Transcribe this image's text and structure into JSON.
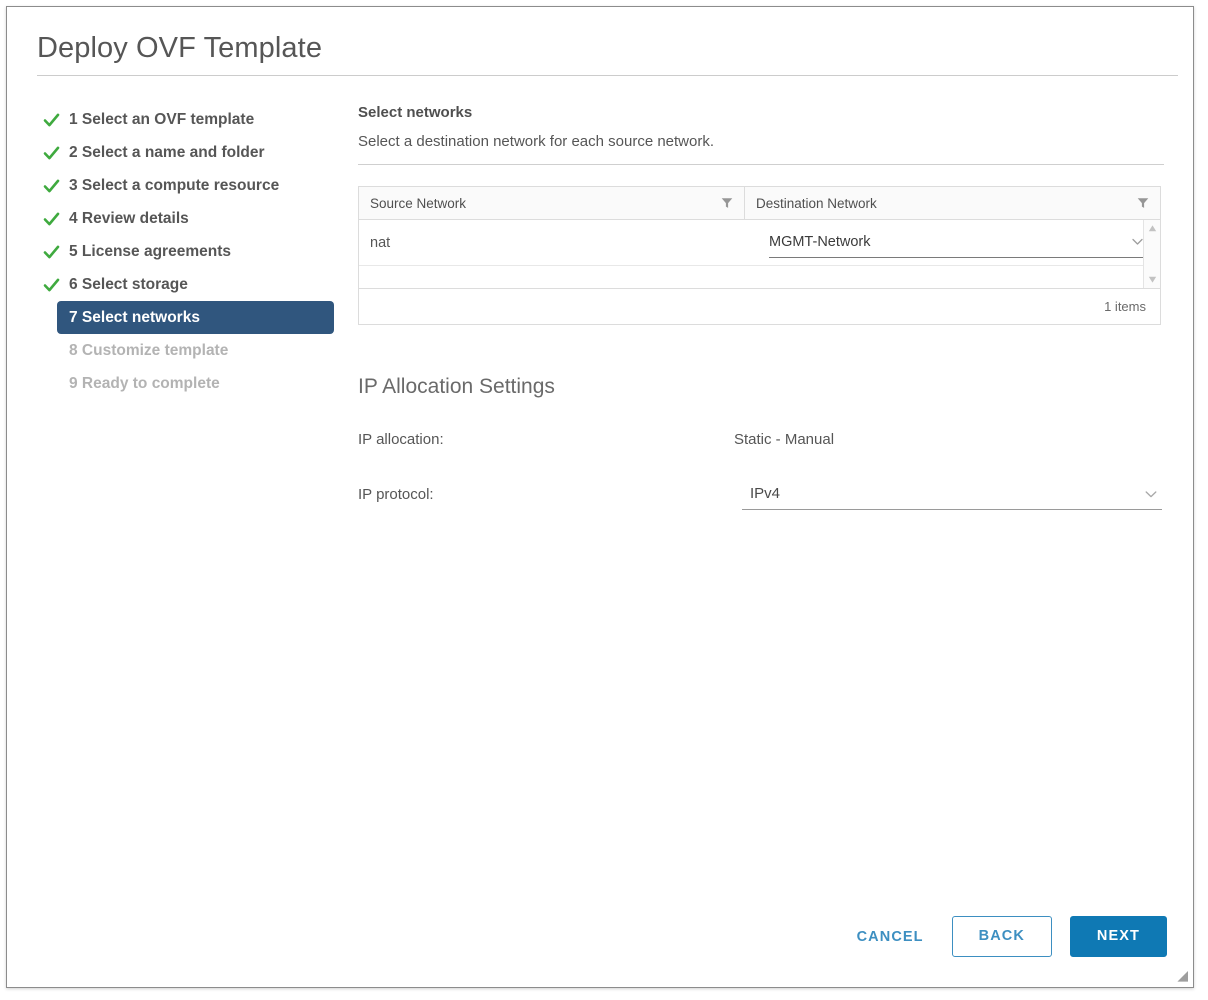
{
  "window": {
    "title": "Deploy OVF Template"
  },
  "nav": {
    "items": [
      {
        "label": "1 Select an OVF template",
        "state": "done"
      },
      {
        "label": "2 Select a name and folder",
        "state": "done"
      },
      {
        "label": "3 Select a compute resource",
        "state": "done"
      },
      {
        "label": "4 Review details",
        "state": "done"
      },
      {
        "label": "5 License agreements",
        "state": "done"
      },
      {
        "label": "6 Select storage",
        "state": "done"
      },
      {
        "label": "7 Select networks",
        "state": "active"
      },
      {
        "label": "8 Customize template",
        "state": "pending"
      },
      {
        "label": "9 Ready to complete",
        "state": "pending"
      }
    ]
  },
  "main": {
    "heading": "Select networks",
    "subheading": "Select a destination network for each source network.",
    "grid": {
      "columns": [
        "Source Network",
        "Destination Network"
      ],
      "rows": [
        {
          "source": "nat",
          "destination": "MGMT-Network"
        }
      ],
      "footer_count": "1 items"
    },
    "ip_allocation": {
      "heading": "IP Allocation Settings",
      "allocation_label": "IP allocation:",
      "allocation_value": "Static - Manual",
      "protocol_label": "IP protocol:",
      "protocol_value": "IPv4"
    }
  },
  "footer": {
    "cancel": "CANCEL",
    "back": "BACK",
    "next": "NEXT"
  },
  "colors": {
    "accent_primary": "#0f79b4",
    "accent_link": "#3d8fc1",
    "nav_active_bg": "#30567e",
    "check_green": "#3faa3f",
    "text_default": "#565656",
    "text_muted": "#b3b3b3"
  }
}
